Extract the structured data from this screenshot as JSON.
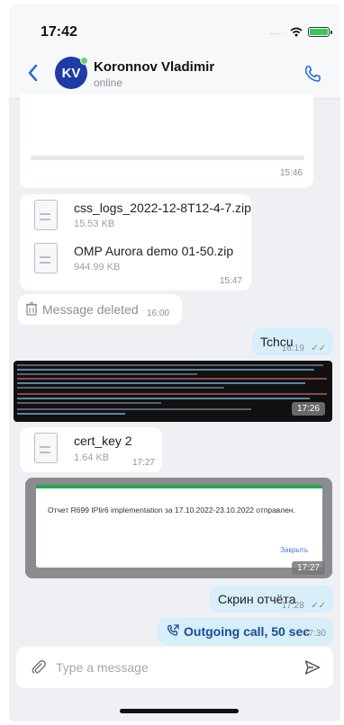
{
  "status_bar": {
    "time": "17:42",
    "signal": "....."
  },
  "header": {
    "avatar_initials": "KV",
    "name": "Koronnov Vladimir",
    "status": "online"
  },
  "messages": {
    "top": {
      "time": "15:46"
    },
    "files": [
      {
        "name": "css_logs_2022-12-8T12-4-7.zip",
        "size": "15.53 KB"
      },
      {
        "name": "OMP Aurora demo 01-50.zip",
        "size": "944.99 KB"
      }
    ],
    "files_time": "15:47",
    "deleted": {
      "text": "Message deleted",
      "time": "16:00"
    },
    "tchcu": {
      "text": "Tchcu",
      "time": "16:19",
      "check": "✓✓"
    },
    "log_image": {
      "time": "17:26"
    },
    "cert": {
      "name": "cert_key 2",
      "size": "1.64 KB",
      "time": "17:27"
    },
    "report": {
      "text": "Отчет R699 IPlir6 implementation за 17.10.2022-23.10.2022 отправлен.",
      "close_label": "Закрыть",
      "time": "17:27"
    },
    "screen": {
      "text": "Скрин отчёта",
      "time": "17:28",
      "check": "✓✓"
    },
    "call": {
      "text": "Outgoing call, 50 sec",
      "time": "17:30"
    }
  },
  "composer": {
    "placeholder": "Type a message"
  },
  "colors": {
    "accent": "#1f3ba8",
    "outgoing_bubble": "#d7eefb",
    "report_bar": "#22a852",
    "link": "#3b7bd6"
  },
  "icons": [
    "chevron-left-icon",
    "phone-icon",
    "file-icon",
    "trash-icon",
    "outgoing-call-icon",
    "paperclip-icon",
    "send-icon",
    "wifi-icon",
    "battery-icon"
  ]
}
